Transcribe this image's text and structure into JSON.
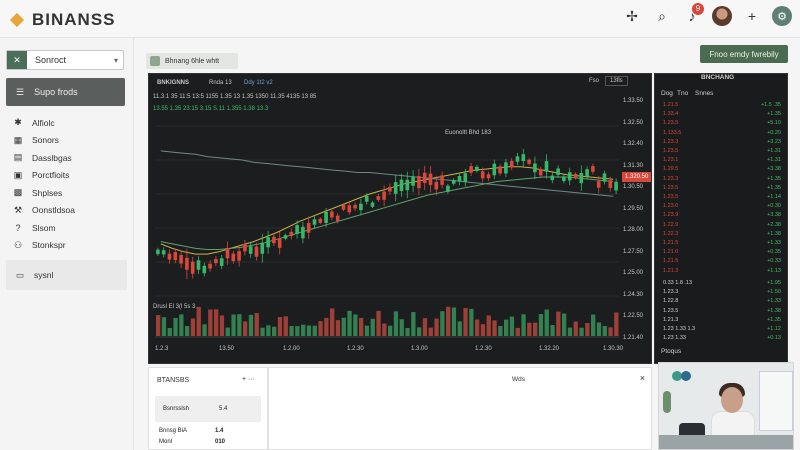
{
  "app": {
    "name": "BINANSS",
    "notification_count": "9",
    "teal_button_label": "⚙"
  },
  "sidebar": {
    "search_text": "Sonroct",
    "active_item": "Supo frods",
    "items": [
      {
        "label": "Alfiolc",
        "icon": "alert-icon"
      },
      {
        "label": "Sonors",
        "icon": "chart-icon"
      },
      {
        "label": "Dasslbgas",
        "icon": "dashboard-icon"
      },
      {
        "label": "Porctfioits",
        "icon": "portfolio-icon"
      },
      {
        "label": "Shplses",
        "icon": "grid-icon"
      },
      {
        "label": "Oonstldsoa",
        "icon": "tools-icon"
      },
      {
        "label": "Slsom",
        "icon": "question-icon"
      },
      {
        "label": "Stonkspr",
        "icon": "person-icon"
      }
    ],
    "bottom_item": "sysnl"
  },
  "main": {
    "tab_label": "Bhnang 6hle whtt",
    "cta_label": "Fnoo emdy fwrebily"
  },
  "chart": {
    "header_left": "BNKIGNNS",
    "header_mid1": "Rnda  13",
    "header_mid2": "Ddy  1t2  v2",
    "header_right1": "Fso",
    "header_right2": "13fls",
    "ohlc_row1": "11.3.1 35  11:5 13:5   1155 1.35 13  1.35 1350  11.35 4135  13 85",
    "ohlc_row2": "13.55 1.35 23:15 3.15 S.11  1.355  1.38  13.3",
    "annotation": "Euonoltt Bhd 183",
    "volume_label": "Drusl  El 3(l 5s 3",
    "last_price": "1.320.50",
    "y_labels": [
      "1.33.50",
      "1.32.50",
      "1.32.40",
      "1.31.30",
      "1.30.50",
      "1.29.50",
      "1.28.00",
      "1.27.50",
      "1.25.00",
      "1.24.30",
      "1.22.50",
      "1.21.40"
    ],
    "x_labels": [
      "1.2.3",
      "13.50",
      "1.2.00",
      "1.2.30",
      "1.3.00",
      "1.2.30",
      "1.32.20",
      "1.30.30"
    ],
    "colors": {
      "up": "#35b86a",
      "down": "#d9483b",
      "ma_yellow": "#c9b34a",
      "ma_green": "#5fa26a"
    }
  },
  "chart_data": {
    "type": "candlestick",
    "title": "BNKIGNNS",
    "ylim": [
      1.2,
      1.35
    ],
    "candles_trend": [
      1.239,
      1.234,
      1.231,
      1.228,
      1.226,
      1.232,
      1.237,
      1.239,
      1.241,
      1.244,
      1.249,
      1.254,
      1.259,
      1.264,
      1.269,
      1.272,
      1.276,
      1.279,
      1.284,
      1.289,
      1.294,
      1.298,
      1.301,
      1.303,
      1.301,
      1.297,
      1.306,
      1.309,
      1.307,
      1.312,
      1.316,
      1.319,
      1.316,
      1.311,
      1.306,
      1.303,
      1.305,
      1.309,
      1.302,
      1.299
    ],
    "series": [
      {
        "name": "MA fast",
        "values": [
          1.246,
          1.242,
          1.239,
          1.237,
          1.237,
          1.239,
          1.242,
          1.245,
          1.248,
          1.252,
          1.256,
          1.261,
          1.266,
          1.27,
          1.274,
          1.278,
          1.282,
          1.286,
          1.29,
          1.293,
          1.296,
          1.299,
          1.301,
          1.303,
          1.305,
          1.307,
          1.309,
          1.311,
          1.312,
          1.313,
          1.314,
          1.314,
          1.313,
          1.311,
          1.309,
          1.307,
          1.306,
          1.305,
          1.304,
          1.303
        ]
      },
      {
        "name": "MA slow",
        "values": [
          1.248,
          1.246,
          1.244,
          1.242,
          1.241,
          1.241,
          1.242,
          1.243,
          1.245,
          1.247,
          1.25,
          1.253,
          1.256,
          1.259,
          1.262,
          1.265,
          1.268,
          1.271,
          1.274,
          1.277,
          1.28,
          1.283,
          1.286,
          1.289,
          1.291,
          1.293,
          1.295,
          1.297,
          1.299,
          1.301,
          1.302,
          1.303,
          1.304,
          1.305,
          1.305,
          1.305,
          1.304,
          1.303,
          1.302,
          1.301
        ]
      },
      {
        "name": "MA long",
        "values": [
          1.328,
          1.327,
          1.326,
          1.325,
          1.323,
          1.322,
          1.321,
          1.32,
          1.318,
          1.317,
          1.316,
          1.315,
          1.314,
          1.313,
          1.312,
          1.311,
          1.31,
          1.309,
          1.309,
          1.308,
          1.307,
          1.306,
          1.305,
          1.304,
          1.303,
          1.302,
          1.301,
          1.3,
          1.299,
          1.298,
          1.297,
          1.296,
          1.295,
          1.294,
          1.293,
          1.292,
          1.291,
          1.29,
          1.289,
          1.288
        ]
      }
    ]
  },
  "orderbook": {
    "title": "BNCHANG",
    "headers": [
      "Dog",
      "Tno",
      "Snnes"
    ],
    "asks": [
      {
        "p": "1.21.5",
        "q": "+1.5 .35",
        "c": "#d9483b"
      },
      {
        "p": "1.33.4",
        "q": "+1.35",
        "c": "#d9483b"
      },
      {
        "p": "1.23.5",
        "q": "+5.10",
        "c": "#d9483b"
      },
      {
        "p": "1.133.5",
        "q": "+0.20",
        "c": "#d9483b"
      },
      {
        "p": "1.23.3",
        "q": "+3.23",
        "c": "#d9483b"
      },
      {
        "p": "1.23.5",
        "q": "+1.31",
        "c": "#d9483b"
      },
      {
        "p": "1.23.1",
        "q": "+1.31",
        "c": "#d9483b"
      },
      {
        "p": "1.29.5",
        "q": "+3.38",
        "c": "#d9483b"
      },
      {
        "p": "1.23.3",
        "q": "+1.35",
        "c": "#d9483b"
      },
      {
        "p": "1.23.5",
        "q": "+1.35",
        "c": "#d9483b"
      },
      {
        "p": "1.23.5",
        "q": "+1.14",
        "c": "#d9483b"
      },
      {
        "p": "1.23.0",
        "q": "+0.30",
        "c": "#d9483b"
      },
      {
        "p": "1.23.9",
        "q": "+3.38",
        "c": "#d9483b"
      },
      {
        "p": "1.22.9",
        "q": "+2.38",
        "c": "#d9483b"
      },
      {
        "p": "1.22.3",
        "q": "+1.38",
        "c": "#d9483b"
      },
      {
        "p": "1.21.5",
        "q": "+1.33",
        "c": "#d9483b"
      },
      {
        "p": "1.21.0",
        "q": "+0.35",
        "c": "#d9483b"
      },
      {
        "p": "1.21.5",
        "q": "+0.33",
        "c": "#d9483b"
      },
      {
        "p": "1.21.3",
        "q": "+1.13",
        "c": "#d9483b"
      }
    ],
    "bids": [
      {
        "p": "0.33 1.8 .13",
        "q": "+1.95"
      },
      {
        "p": "1.23.3",
        "q": "+1.50"
      },
      {
        "p": "1.22.8",
        "q": "+1.33"
      },
      {
        "p": "1.23.5",
        "q": "+1.38"
      },
      {
        "p": "1.21.3",
        "q": "+1.35"
      },
      {
        "p": "1.23 1.33 1.3",
        "q": "+1.12"
      },
      {
        "p": "1.23 1.33",
        "q": "+0.13"
      }
    ],
    "footer": "Ptoqus"
  },
  "bottom": {
    "panel1_title": "BTANSBS",
    "panel1_ctrl": "+  ···",
    "row1_label": "Bsnrsslsh",
    "row1_value": "5.4",
    "row2_label": "Bnnsg BiA",
    "row2_value": "1.4",
    "row3_label": "Monl",
    "row3_value": "010",
    "panel2_title": "Wds",
    "panel2_close": "×"
  }
}
